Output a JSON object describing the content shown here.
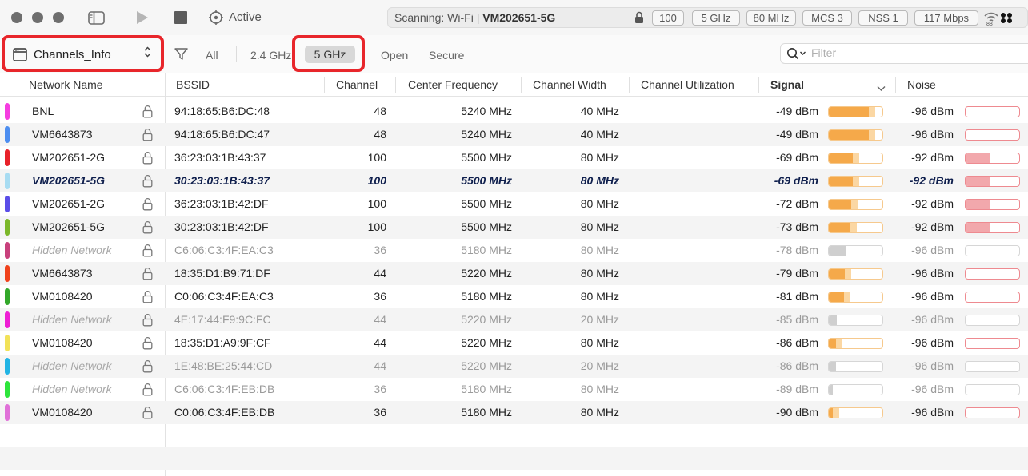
{
  "toolbar": {
    "status": "Active",
    "scanning_label": "Scanning: Wi-Fi  |",
    "scanning_ssid": "VM202651-5G",
    "pills": [
      "100",
      "5 GHz",
      "80 MHz",
      "MCS 3",
      "NSS 1",
      "117 Mbps"
    ]
  },
  "filterbar": {
    "profile": "Channels_Info",
    "filters": [
      "All",
      "2.4 GHz",
      "5 GHz",
      "Open",
      "Secure"
    ],
    "search_placeholder": "Filter"
  },
  "table": {
    "columns": [
      "Network Name",
      "BSSID",
      "Channel",
      "Center Frequency",
      "Channel Width",
      "Channel Utilization",
      "Signal",
      "Noise"
    ],
    "sorted_column": "Signal",
    "rows": [
      {
        "name": "BNL",
        "color": "#f53de0",
        "bssid": "94:18:65:B6:DC:48",
        "channel": "48",
        "freq": "5240 MHz",
        "width": "40 MHz",
        "signal": "-49 dBm",
        "signal_level": 0.75,
        "noise": "-96 dBm",
        "noise_level": 0.0,
        "style": "normal"
      },
      {
        "name": "VM6643873",
        "color": "#4d8ef0",
        "bssid": "94:18:65:B6:DC:47",
        "channel": "48",
        "freq": "5240 MHz",
        "width": "40 MHz",
        "signal": "-49 dBm",
        "signal_level": 0.75,
        "noise": "-96 dBm",
        "noise_level": 0.0,
        "style": "normal"
      },
      {
        "name": "VM202651-2G",
        "color": "#e8222a",
        "bssid": "36:23:03:1B:43:37",
        "channel": "100",
        "freq": "5500 MHz",
        "width": "80 MHz",
        "signal": "-69 dBm",
        "signal_level": 0.45,
        "noise": "-92 dBm",
        "noise_level": 0.45,
        "style": "normal"
      },
      {
        "name": "VM202651-5G",
        "color": "#a8dcf2",
        "bssid": "30:23:03:1B:43:37",
        "channel": "100",
        "freq": "5500 MHz",
        "width": "80 MHz",
        "signal": "-69 dBm",
        "signal_level": 0.45,
        "noise": "-92 dBm",
        "noise_level": 0.45,
        "style": "current"
      },
      {
        "name": "VM202651-2G",
        "color": "#5a4de8",
        "bssid": "36:23:03:1B:42:DF",
        "channel": "100",
        "freq": "5500 MHz",
        "width": "80 MHz",
        "signal": "-72 dBm",
        "signal_level": 0.42,
        "noise": "-92 dBm",
        "noise_level": 0.45,
        "style": "normal"
      },
      {
        "name": "VM202651-5G",
        "color": "#7cb82a",
        "bssid": "30:23:03:1B:42:DF",
        "channel": "100",
        "freq": "5500 MHz",
        "width": "80 MHz",
        "signal": "-73 dBm",
        "signal_level": 0.4,
        "noise": "-92 dBm",
        "noise_level": 0.45,
        "style": "normal"
      },
      {
        "name": "Hidden Network",
        "color": "#c8407c",
        "bssid": "C6:06:C3:4F:EA:C3",
        "channel": "36",
        "freq": "5180 MHz",
        "width": "80 MHz",
        "signal": "-78 dBm",
        "signal_level": 0.32,
        "noise": "-96 dBm",
        "noise_level": 0.0,
        "style": "hidden"
      },
      {
        "name": "VM6643873",
        "color": "#f0421c",
        "bssid": "18:35:D1:B9:71:DF",
        "channel": "44",
        "freq": "5220 MHz",
        "width": "80 MHz",
        "signal": "-79 dBm",
        "signal_level": 0.3,
        "noise": "-96 dBm",
        "noise_level": 0.0,
        "style": "normal"
      },
      {
        "name": "VM0108420",
        "color": "#33a82a",
        "bssid": "C0:06:C3:4F:EA:C3",
        "channel": "36",
        "freq": "5180 MHz",
        "width": "80 MHz",
        "signal": "-81 dBm",
        "signal_level": 0.28,
        "noise": "-96 dBm",
        "noise_level": 0.0,
        "style": "normal"
      },
      {
        "name": "Hidden Network",
        "color": "#ee1fd4",
        "bssid": "4E:17:44:F9:9C:FC",
        "channel": "44",
        "freq": "5220 MHz",
        "width": "20 MHz",
        "signal": "-85 dBm",
        "signal_level": 0.15,
        "noise": "-96 dBm",
        "noise_level": 0.0,
        "style": "hidden"
      },
      {
        "name": "VM0108420",
        "color": "#f2e258",
        "bssid": "18:35:D1:A9:9F:CF",
        "channel": "44",
        "freq": "5220 MHz",
        "width": "80 MHz",
        "signal": "-86 dBm",
        "signal_level": 0.14,
        "noise": "-96 dBm",
        "noise_level": 0.0,
        "style": "normal"
      },
      {
        "name": "Hidden Network",
        "color": "#22b4e4",
        "bssid": "1E:48:BE:25:44:CD",
        "channel": "44",
        "freq": "5220 MHz",
        "width": "20 MHz",
        "signal": "-86 dBm",
        "signal_level": 0.14,
        "noise": "-96 dBm",
        "noise_level": 0.0,
        "style": "hidden"
      },
      {
        "name": "Hidden Network",
        "color": "#2ee53c",
        "bssid": "C6:06:C3:4F:EB:DB",
        "channel": "36",
        "freq": "5180 MHz",
        "width": "80 MHz",
        "signal": "-89 dBm",
        "signal_level": 0.08,
        "noise": "-96 dBm",
        "noise_level": 0.0,
        "style": "hidden"
      },
      {
        "name": "VM0108420",
        "color": "#e070d8",
        "bssid": "C0:06:C3:4F:EB:DB",
        "channel": "36",
        "freq": "5180 MHz",
        "width": "80 MHz",
        "signal": "-90 dBm",
        "signal_level": 0.07,
        "noise": "-96 dBm",
        "noise_level": 0.0,
        "style": "normal"
      }
    ]
  },
  "colors": {
    "signal_bar": "#f5a94a",
    "signal_bar_pale": "#fbd7a3",
    "signal_bar_hidden": "#cfcfcf",
    "noise_bar": "#f2a8ac",
    "noise_border": "#ee8a90",
    "highlight": "#e8262b"
  }
}
